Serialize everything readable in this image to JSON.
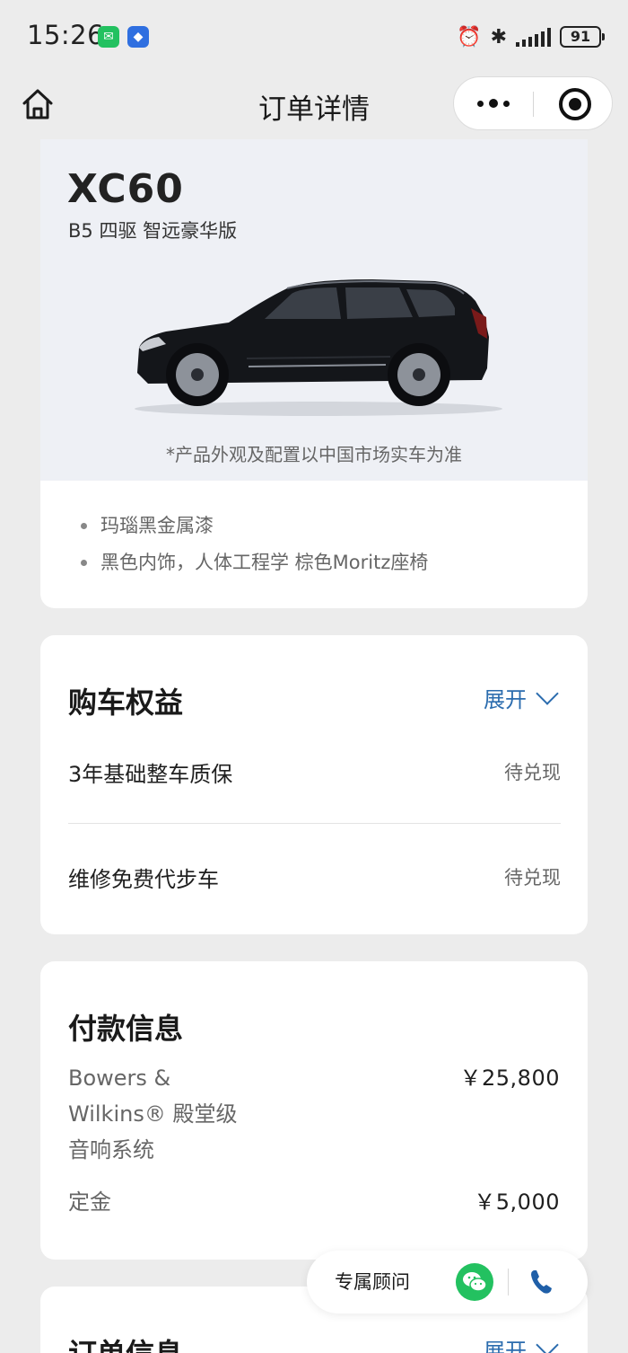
{
  "status_bar": {
    "time": "15:26",
    "battery": "91",
    "icons": [
      "wechat-notification-icon",
      "app-notification-icon",
      "alarm-icon",
      "bluetooth-icon",
      "signal-icon",
      "battery-icon"
    ]
  },
  "nav": {
    "title": "订单详情"
  },
  "car": {
    "model": "XC60",
    "trim": "B5 四驱 智远豪华版",
    "disclaimer": "*产品外观及配置以中国市场实车为准",
    "options": [
      "玛瑙黑金属漆",
      "黑色内饰，人体工程学 棕色Moritz座椅"
    ],
    "body_color": "#14161a"
  },
  "benefits": {
    "title": "购车权益",
    "expand_label": "展开",
    "items": [
      {
        "name": "3年基础整车质保",
        "status": "待兑现"
      },
      {
        "name": "维修免费代步车",
        "status": "待兑现"
      }
    ]
  },
  "payment": {
    "title": "付款信息",
    "items": [
      {
        "name": "Bowers & Wilkins® 殿堂级音响系统",
        "price": "￥25,800"
      },
      {
        "name": "定金",
        "price": "￥5,000"
      }
    ]
  },
  "order": {
    "title": "订单信息",
    "expand_label": "展开"
  },
  "advisor": {
    "label": "专属顾问"
  },
  "colors": {
    "accent_blue": "#2b6cae",
    "wechat_green": "#23c160",
    "page_bg": "#ececec",
    "hero_bg": "#eef0f5"
  }
}
